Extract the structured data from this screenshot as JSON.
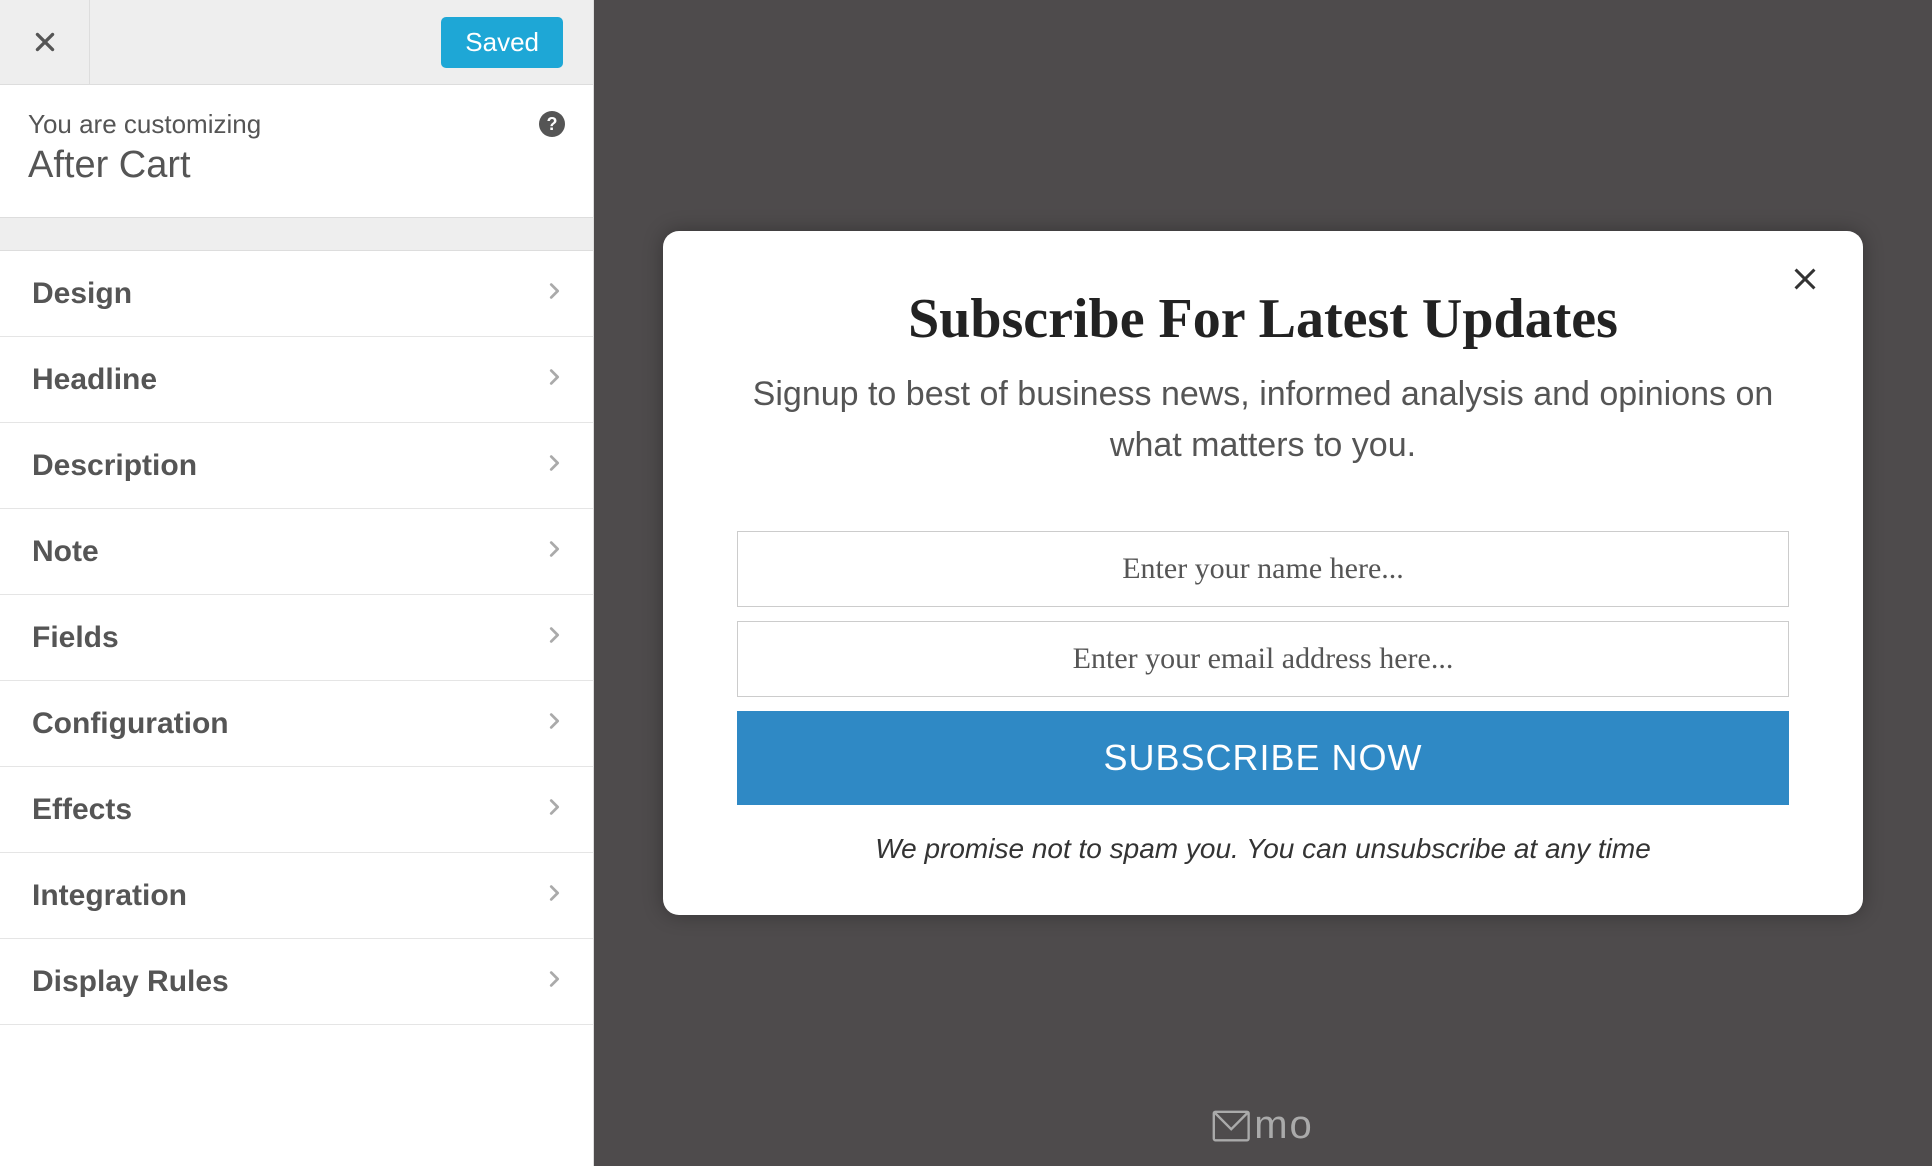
{
  "topbar": {
    "saved_label": "Saved"
  },
  "context": {
    "label": "You are customizing",
    "title": "After Cart",
    "help_glyph": "?"
  },
  "sidebar": {
    "items": [
      {
        "label": "Design"
      },
      {
        "label": "Headline"
      },
      {
        "label": "Description"
      },
      {
        "label": "Note"
      },
      {
        "label": "Fields"
      },
      {
        "label": "Configuration"
      },
      {
        "label": "Effects"
      },
      {
        "label": "Integration"
      },
      {
        "label": "Display Rules"
      }
    ]
  },
  "modal": {
    "title": "Subscribe For Latest Updates",
    "description": "Signup to best of business news, informed analysis and opinions on what matters to you.",
    "name_placeholder": "Enter your name here...",
    "email_placeholder": "Enter your email address here...",
    "submit_label": "SUBSCRIBE NOW",
    "note": "We promise not to spam you. You can unsubscribe at any time"
  },
  "brand": {
    "text": "mo"
  }
}
